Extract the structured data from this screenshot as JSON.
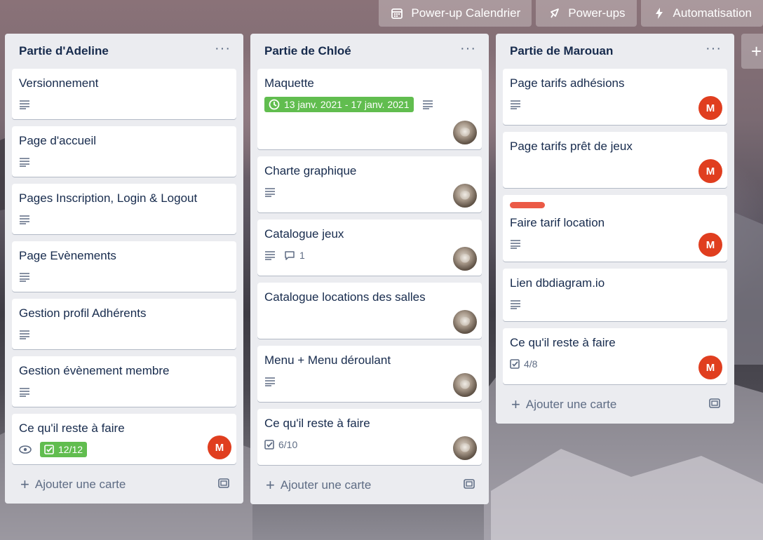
{
  "topbar": {
    "calendar": "Power-up Calendrier",
    "powerups": "Power-ups",
    "automation": "Automatisation"
  },
  "add_list_icon": "+",
  "add_card_label": "Ajouter une carte",
  "list_menu_icon": "···",
  "colors": {
    "list_bg": "#ebecf0",
    "green_badge": "#61bd4f",
    "avatar_red": "#e03e1f",
    "label_red": "#eb5a46",
    "text": "#172b4d",
    "muted": "#5e6c84"
  },
  "lists": [
    {
      "title": "Partie d'Adeline",
      "cards": [
        {
          "title": "Versionnement"
        },
        {
          "title": "Page d'accueil"
        },
        {
          "title": "Pages Inscription, Login & Logout"
        },
        {
          "title": "Page Evènements"
        },
        {
          "title": "Gestion profil Adhérents"
        },
        {
          "title": "Gestion évènement membre"
        },
        {
          "title": "Ce qu'il reste à faire",
          "checklist": "12/12",
          "avatar": "M"
        }
      ]
    },
    {
      "title": "Partie de Chloé",
      "cards": [
        {
          "title": "Maquette",
          "dates": "13 janv. 2021 - 17 janv. 2021"
        },
        {
          "title": "Charte graphique"
        },
        {
          "title": "Catalogue jeux",
          "comments": "1"
        },
        {
          "title": "Catalogue locations des salles"
        },
        {
          "title": "Menu + Menu déroulant"
        },
        {
          "title": "Ce qu'il reste à faire",
          "checklist": "6/10"
        }
      ]
    },
    {
      "title": "Partie de Marouan",
      "cards": [
        {
          "title": "Page tarifs adhésions",
          "avatar": "M"
        },
        {
          "title": "Page tarifs prêt de jeux",
          "avatar": "M"
        },
        {
          "title": "Faire tarif location",
          "avatar": "M"
        },
        {
          "title": "Lien dbdiagram.io"
        },
        {
          "title": "Ce qu'il reste à faire",
          "checklist": "4/8",
          "avatar": "M"
        }
      ]
    }
  ]
}
